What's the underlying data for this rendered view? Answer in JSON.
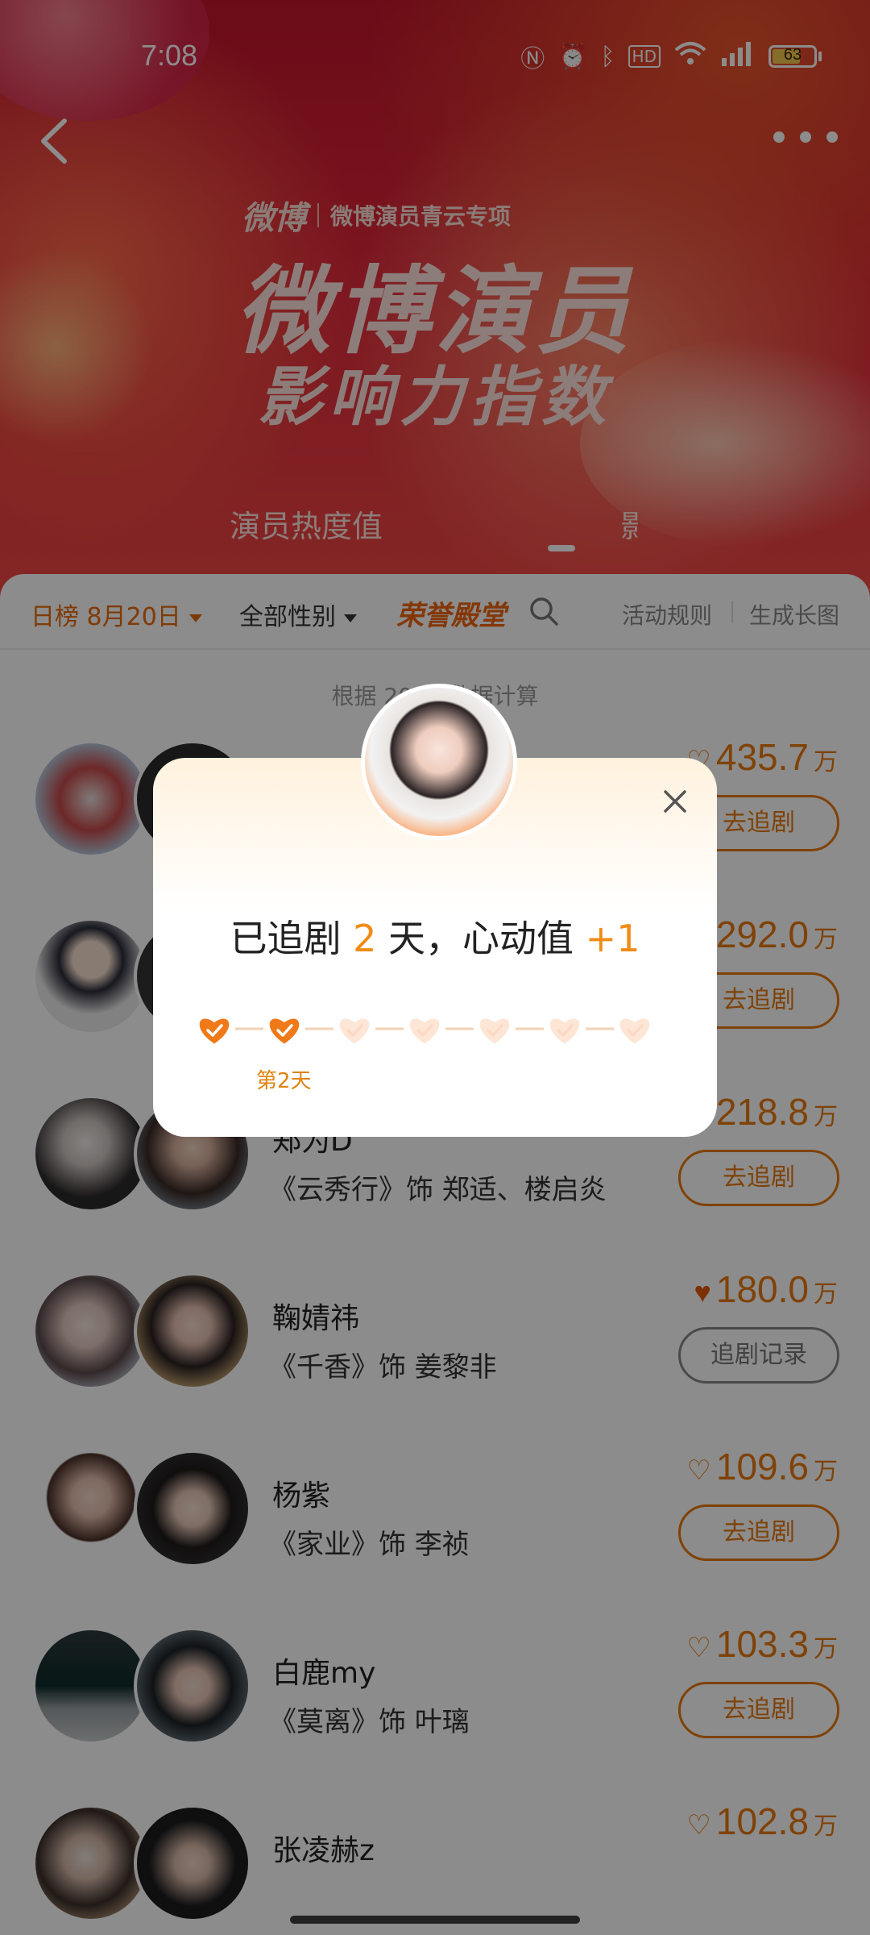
{
  "status_bar": {
    "time": "7:08",
    "battery": "63"
  },
  "hero": {
    "brand_logo": "微博",
    "brand_sub": "微博演员青云专项",
    "title": "微博演员",
    "subtitle": "影响力指数",
    "tab_active": "演员热度值",
    "tab_partial": "影",
    "colors": {
      "top": "#c2152b",
      "bottom": "#f24a45"
    }
  },
  "filters": {
    "date": "日榜 8月20日",
    "gender": "全部性别",
    "honor": "荣誉殿堂",
    "rules": "活动规则",
    "poster": "生成长图",
    "accent": "#e86a0a"
  },
  "note": "根据 2026          数据计算",
  "rows": [
    {
      "name": "",
      "role": "",
      "score": "435.7",
      "unit": "万",
      "heart": "outline",
      "button": "去追剧"
    },
    {
      "name": "",
      "role": "",
      "score": "292.0",
      "unit": "万",
      "heart": "outline",
      "button": "去追剧"
    },
    {
      "name": "郑为D",
      "role": "《云秀行》饰 郑适、楼启炎",
      "score": "218.8",
      "unit": "万",
      "heart": "outline",
      "button": "去追剧"
    },
    {
      "name": "鞠婧祎",
      "role": "《千香》饰 姜黎非",
      "score": "180.0",
      "unit": "万",
      "heart": "solid",
      "button": "追剧记录"
    },
    {
      "name": "杨紫",
      "role": "《家业》饰 李祯",
      "score": "109.6",
      "unit": "万",
      "heart": "outline",
      "button": "去追剧"
    },
    {
      "name": "白鹿my",
      "role": "《莫离》饰 叶璃",
      "score": "103.3",
      "unit": "万",
      "heart": "outline",
      "button": "去追剧"
    },
    {
      "name": "张凌赫z",
      "role": "",
      "score": "102.8",
      "unit": "万",
      "heart": "outline",
      "button": ""
    }
  ],
  "modal": {
    "title_prefix": "已追剧",
    "days": "2",
    "title_mid": "天，心动值",
    "bonus": "+1",
    "total_steps": 7,
    "filled_steps": 2,
    "day_caption": "第2天",
    "accent": "#f08c16"
  },
  "icons": {
    "back": "chevron-left-icon",
    "more": "more-dots-icon",
    "search": "search-icon",
    "close": "close-icon",
    "heart": "heart-icon"
  }
}
